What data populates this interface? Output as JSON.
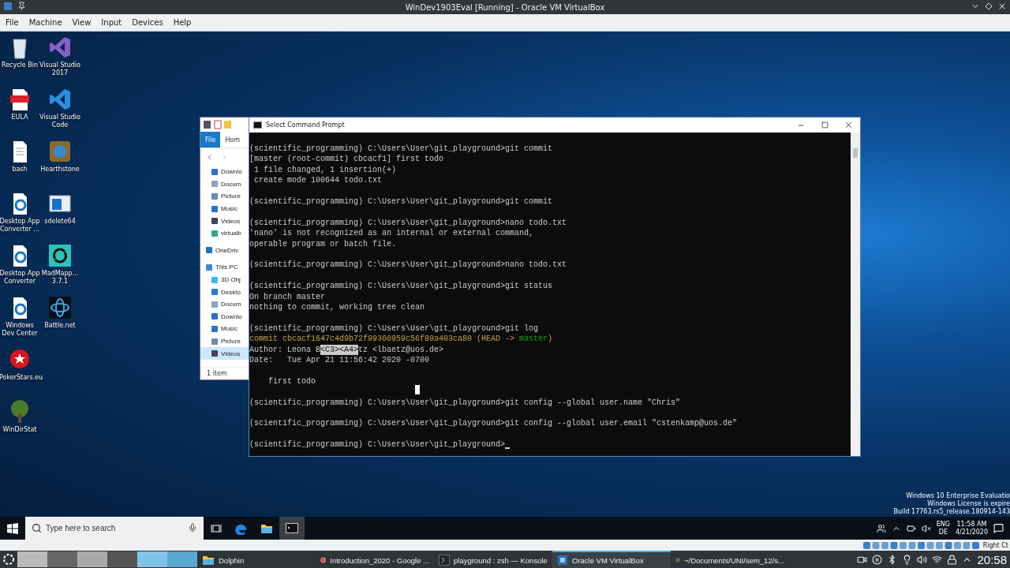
{
  "host_window": {
    "title": "WinDev1903Eval [Running] - Oracle VM VirtualBox"
  },
  "menu": [
    "File",
    "Machine",
    "View",
    "Input",
    "Devices",
    "Help"
  ],
  "desktop_icons": [
    {
      "label": "Recycle Bin",
      "kind": "recycle"
    },
    {
      "label": "EULA",
      "kind": "pdf"
    },
    {
      "label": "bash",
      "kind": "file"
    },
    {
      "label": "Desktop App Converter ...",
      "kind": "edgedoc"
    },
    {
      "label": "Desktop App Converter",
      "kind": "edgedoc"
    },
    {
      "label": "Windows Dev Center",
      "kind": "edgedoc"
    },
    {
      "label": "PokerStars.eu",
      "kind": "spade"
    },
    {
      "label": "WinDirStat",
      "kind": "tree"
    },
    {
      "label": "Visual Studio 2017",
      "kind": "vs"
    },
    {
      "label": "Visual Studio Code",
      "kind": "vscode"
    },
    {
      "label": "Hearthstone",
      "kind": "game"
    },
    {
      "label": "sdelete64",
      "kind": "window"
    },
    {
      "label": "MadMapp... 3.7.1",
      "kind": "madmapper"
    },
    {
      "label": "Battle.net",
      "kind": "battlenet"
    }
  ],
  "explorer": {
    "ribbon_tabs": [
      {
        "label": "File",
        "selected": true
      },
      {
        "label": "Hom",
        "selected": false
      }
    ],
    "nav_items": [
      {
        "label": "Downlo",
        "kind": "download",
        "selected": false
      },
      {
        "label": "Docum",
        "kind": "doc",
        "selected": false
      },
      {
        "label": "Picture",
        "kind": "picture",
        "selected": false
      },
      {
        "label": "Music",
        "kind": "music",
        "selected": false
      },
      {
        "label": "Videos",
        "kind": "video",
        "selected": false
      },
      {
        "label": "virtualb",
        "kind": "drive",
        "selected": false
      },
      {
        "label": "OneDriv",
        "kind": "cloud",
        "selected": false
      },
      {
        "label": "This PC",
        "kind": "pc",
        "selected": false
      },
      {
        "label": "3D Obj",
        "kind": "cube",
        "selected": false
      },
      {
        "label": "Deskto",
        "kind": "desktop",
        "selected": false
      },
      {
        "label": "Docum",
        "kind": "doc",
        "selected": false
      },
      {
        "label": "Downlo",
        "kind": "download",
        "selected": false
      },
      {
        "label": "Music",
        "kind": "music",
        "selected": false
      },
      {
        "label": "Picture",
        "kind": "picture",
        "selected": false
      },
      {
        "label": "Videos",
        "kind": "video",
        "selected": true
      }
    ],
    "status": "1 item"
  },
  "console": {
    "title": "Select Command Prompt",
    "blocks": [
      [
        {
          "parts": [
            {
              "text": "(scientific_programming) C:\\Users\\User\\git_playground>git commit",
              "kind": "plain"
            }
          ]
        },
        {
          "parts": [
            {
              "text": "[master (root-commit) cbcacf1] first todo",
              "kind": "plain"
            }
          ]
        },
        {
          "parts": [
            {
              "text": " 1 file changed, 1 insertion(+)",
              "kind": "plain"
            }
          ]
        },
        {
          "parts": [
            {
              "text": " create mode 100644 todo.txt",
              "kind": "plain"
            }
          ]
        }
      ],
      [
        {
          "parts": [
            {
              "text": "(scientific_programming) C:\\Users\\User\\git_playground>git commit",
              "kind": "plain"
            }
          ]
        }
      ],
      [
        {
          "parts": [
            {
              "text": "(scientific_programming) C:\\Users\\User\\git_playground>nano todo.txt",
              "kind": "plain"
            }
          ]
        },
        {
          "parts": [
            {
              "text": "'nano' is not recognized as an internal or external command,",
              "kind": "plain"
            }
          ]
        },
        {
          "parts": [
            {
              "text": "operable program or batch file.",
              "kind": "plain"
            }
          ]
        }
      ],
      [
        {
          "parts": [
            {
              "text": "(scientific_programming) C:\\Users\\User\\git_playground>nano todo.txt",
              "kind": "plain"
            }
          ]
        }
      ],
      [
        {
          "parts": [
            {
              "text": "(scientific_programming) C:\\Users\\User\\git_playground>git status",
              "kind": "plain"
            }
          ]
        },
        {
          "parts": [
            {
              "text": "On branch master",
              "kind": "plain"
            }
          ]
        },
        {
          "parts": [
            {
              "text": "nothing to commit, working tree clean",
              "kind": "plain"
            }
          ]
        }
      ],
      [
        {
          "parts": [
            {
              "text": "(scientific_programming) C:\\Users\\User\\git_playground>git log",
              "kind": "plain"
            }
          ]
        },
        {
          "parts": [
            {
              "text": "commit cbcacf1647c4d9b72f99360959c56f80a403ca80 (HEAD -> ",
              "kind": "yellow"
            },
            {
              "text": "master",
              "kind": "green"
            },
            {
              "text": ")",
              "kind": "yellow"
            }
          ]
        },
        {
          "parts": [
            {
              "text": "Author: Leona B",
              "kind": "plain"
            },
            {
              "text": "<C3><A4>",
              "kind": "selected"
            },
            {
              "text": "tz <lbaetz@uos.de>",
              "kind": "plain"
            }
          ]
        },
        {
          "parts": [
            {
              "text": "Date:   Tue Apr 21 11:56:42 2020 -0700",
              "kind": "plain"
            }
          ]
        }
      ],
      [
        {
          "parts": [
            {
              "text": "    first todo",
              "kind": "plain"
            }
          ]
        }
      ],
      [
        {
          "parts": [
            {
              "text": "(scientific_programming) C:\\Users\\User\\git_playground>git config --global user.name \"Chris\"",
              "kind": "plain"
            }
          ]
        }
      ],
      [
        {
          "parts": [
            {
              "text": "(scientific_programming) C:\\Users\\User\\git_playground>git config --global user.email \"cstenkamp@uos.de\"",
              "kind": "plain"
            }
          ]
        }
      ],
      [
        {
          "parts": [
            {
              "text": "(scientific_programming) C:\\Users\\User\\git_playground>",
              "kind": "plain"
            }
          ],
          "cursor": true
        }
      ]
    ]
  },
  "activation_notice": [
    "Windows 10 Enterprise Evaluatio",
    "Windows License is expire",
    "Build 17763.rs5_release.180914-143"
  ],
  "win_taskbar": {
    "search": {
      "placeholder": "Type here to search"
    },
    "apps": [
      {
        "kind": "taskview",
        "selected": false
      },
      {
        "kind": "edge",
        "selected": false
      },
      {
        "kind": "folder",
        "selected": false
      },
      {
        "kind": "cmd",
        "selected": true
      }
    ],
    "lang": [
      "ENG",
      "DE"
    ],
    "time": "11:58 AM",
    "date": "4/21/2020"
  },
  "vbox_status": {
    "host_key": "Right Ct"
  },
  "kde_panel": {
    "tasks": [
      {
        "label": "Dolphin",
        "kind": "folder",
        "selected": false
      },
      {
        "label": "Introduction_2020 - Google ...",
        "kind": "firefox",
        "selected": false
      },
      {
        "label": "playground : zsh — Konsole",
        "kind": "terminal",
        "selected": false
      },
      {
        "label": "Oracle VM VirtualBox",
        "kind": "vbox",
        "selected": true
      },
      {
        "label": "~/Documents/UNI/sem_12/s...",
        "kind": "sublime",
        "selected": false
      }
    ],
    "clock": "20:58"
  }
}
